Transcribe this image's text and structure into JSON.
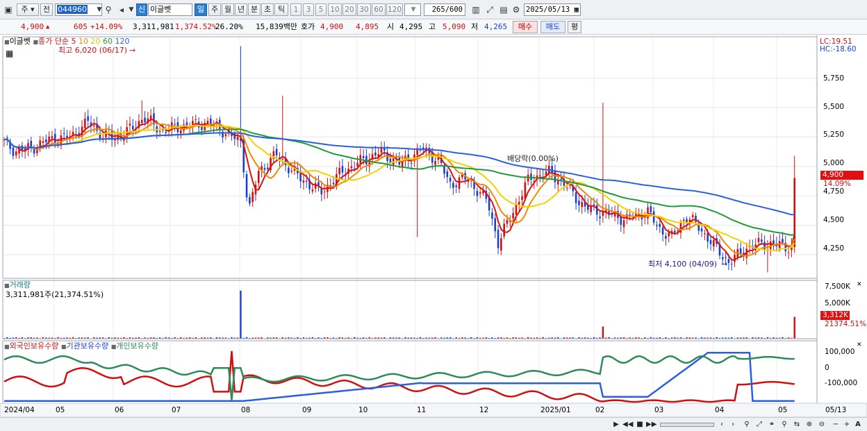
{
  "toolbar": {
    "market_type": "주",
    "prev": "전",
    "stock_code": "044960",
    "new_badge": "신",
    "stock_name": "이글벳",
    "periods": [
      "일",
      "주",
      "월",
      "년",
      "분",
      "초",
      "틱"
    ],
    "active_period": "일",
    "intervals": [
      "1",
      "3",
      "5",
      "10",
      "20",
      "30",
      "60",
      "120"
    ],
    "count_display": "265",
    "count_total": "/600",
    "date": "2025/05/13"
  },
  "quote": {
    "price": "4,900",
    "change": "605",
    "change_pct": "+14.09%",
    "volume": "3,311,981",
    "volume_ratio": "1,374.52%",
    "turnover": "26.20%",
    "amount": "15,839백만",
    "bid_label": "호가",
    "ask": "4,900",
    "bid": "4,895",
    "open_label": "시",
    "open": "4,295",
    "high_label": "고",
    "high": "5,090",
    "low_label": "저",
    "low": "4,265",
    "buy_label": "매수",
    "sell_label": "매도",
    "flat_label": "평"
  },
  "price_panel": {
    "legend_name": "이글벳",
    "legend_ma": "종가 단순",
    "ma_periods": [
      {
        "label": "5",
        "color": "#e01010"
      },
      {
        "label": "10",
        "color": "#f08a00"
      },
      {
        "label": "20",
        "color": "#f2d200"
      },
      {
        "label": "60",
        "color": "#1f9a3a"
      },
      {
        "label": "120",
        "color": "#2a5fe0"
      }
    ],
    "max_note": "최고 6,020 (06/17)",
    "min_note": "최저 4,100 (04/09)",
    "dividend_note": "배당락(0.00%)",
    "lc": "LC:19.51",
    "hc": "HC:-18.60",
    "y_ticks": [
      "5,750",
      "5,500",
      "5,250",
      "5,000",
      "4,750",
      "4,500",
      "4,250"
    ],
    "last_price_tag": "4,900",
    "last_pct_tag": "14.09%"
  },
  "volume_panel": {
    "title": "거래량",
    "value": "3,311,981주(21,374.51%)",
    "y_ticks": [
      "7,500K",
      "5,000K"
    ],
    "last_tag": "3,312K",
    "last_pct_tag": "21374.51%"
  },
  "holding_panel": {
    "series": [
      {
        "name": "외국인보유수량",
        "color": "#d01010"
      },
      {
        "name": "기관보유수량",
        "color": "#2a5fe0"
      },
      {
        "name": "개인보유수량",
        "color": "#2e8b57"
      }
    ],
    "y_ticks": [
      "100,000",
      "0",
      "-100,000"
    ]
  },
  "x_axis": {
    "labels": [
      "2024/04",
      "05",
      "06",
      "07",
      "08",
      "09",
      "10",
      "11",
      "12",
      "2025/01",
      "02",
      "03",
      "04",
      "05"
    ],
    "right_label": "05/13"
  },
  "colors": {
    "up": "#d01010",
    "down": "#1a3fcf"
  }
}
